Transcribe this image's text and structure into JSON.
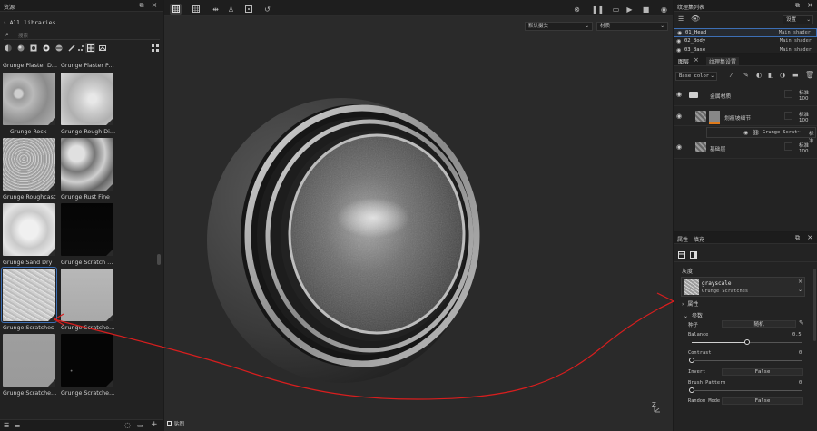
{
  "left": {
    "title": "资源",
    "breadcrumb": "All libraries",
    "search_placeholder": "搜索",
    "grid_items": [
      {
        "label": "Grunge Plaster Da...",
        "kind": "plaster"
      },
      {
        "label": "Grunge Plaster Pai...",
        "kind": "plaster2"
      },
      {
        "label": "Grunge Rock",
        "kind": "rock"
      },
      {
        "label": "Grunge Rough Dirty",
        "kind": "roughdirty"
      },
      {
        "label": "Grunge Roughcast",
        "kind": "roughcast"
      },
      {
        "label": "Grunge Rust Fine",
        "kind": "rust"
      },
      {
        "label": "Grunge Sand Dry",
        "kind": "sand"
      },
      {
        "label": "Grunge Scratch Ge...",
        "kind": "black"
      },
      {
        "label": "Grunge Scratches",
        "kind": "scratches",
        "selected": true
      },
      {
        "label": "Grunge Scratches ...",
        "kind": "scratchesgray"
      },
      {
        "label": "Grunge Scratches ...",
        "kind": "gray"
      },
      {
        "label": "Grunge Scratches ...",
        "kind": "blacknoise"
      }
    ]
  },
  "viewport": {
    "camera_select": "默认摄头",
    "mode_select": "材质",
    "bottom_label": "贴图",
    "axis_label": "Z"
  },
  "texture_sets": {
    "title": "纹理集列表",
    "settings_select": "设置",
    "items": [
      {
        "name": "01_Head",
        "shader": "Main shader",
        "active": true
      },
      {
        "name": "02_Body",
        "shader": "Main shader",
        "active": false
      },
      {
        "name": "03_Base",
        "shader": "Main shader",
        "active": false
      }
    ]
  },
  "layers": {
    "tab_layers": "图层",
    "tab_settings": "纹理集设置",
    "channel_select": "Base color",
    "items": [
      {
        "name": "金属材质",
        "blend": "标准",
        "opacity": "100",
        "type": "folder"
      },
      {
        "name": "划痕坡细节",
        "blend": "标准",
        "opacity": "100",
        "type": "fill"
      },
      {
        "name": "Grunge Scrat~",
        "blend": "标准",
        "opacity": "100",
        "type": "mask"
      },
      {
        "name": "基础层",
        "blend": "标准",
        "opacity": "100",
        "type": "fill"
      }
    ]
  },
  "properties": {
    "title": "属性 - 填充",
    "section_grayscale": "灰度",
    "resource_type": "grayscale",
    "resource_name": "Grunge Scratches",
    "attrs_label": "属性",
    "params_label": "参数",
    "seed_label": "种子",
    "seed_value": "随机",
    "balance_label": "Balance",
    "balance_value": "0.5",
    "balance_level": 0.5,
    "contrast_label": "Contrast",
    "contrast_value": "0",
    "contrast_level": 0,
    "invert_label": "Invert",
    "invert_value": "False",
    "brush_label": "Brush Pattern",
    "brush_value": "0",
    "brush_level": 0,
    "random_label": "Random Mode",
    "random_value": "False"
  },
  "colors": {
    "annotation": "#d81e1e",
    "accent": "#e07a1a",
    "selection": "#3d6fb5"
  }
}
